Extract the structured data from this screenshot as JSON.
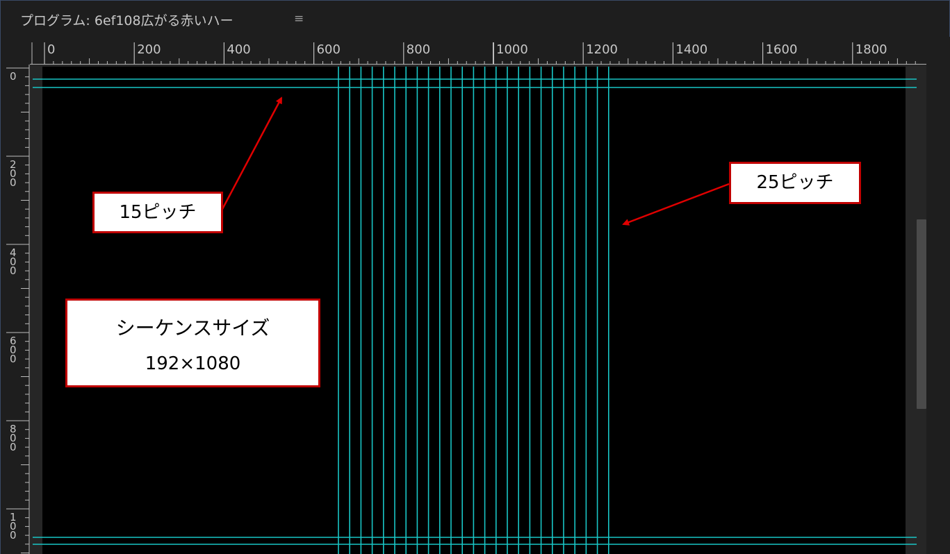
{
  "panel": {
    "title": "プログラム: 6ef108広がる赤いハー",
    "menu_icon": "hamburger-icon",
    "menu_glyph": "≡"
  },
  "ruler": {
    "horizontal_labels": [
      "0",
      "200",
      "400",
      "600",
      "800",
      "1000",
      "1200",
      "1400",
      "1600",
      "1800"
    ],
    "vertical_labels": [
      "0",
      "200",
      "400",
      "600",
      "800",
      "100"
    ]
  },
  "annotations": {
    "pitch15": "15ピッチ",
    "pitch25": "25ピッチ",
    "sequence_title": "シーケンスサイズ",
    "sequence_size": "192×1080"
  },
  "colors": {
    "guide": "#19c6c6",
    "callout_border": "#c00000",
    "arrow": "#e00000"
  }
}
